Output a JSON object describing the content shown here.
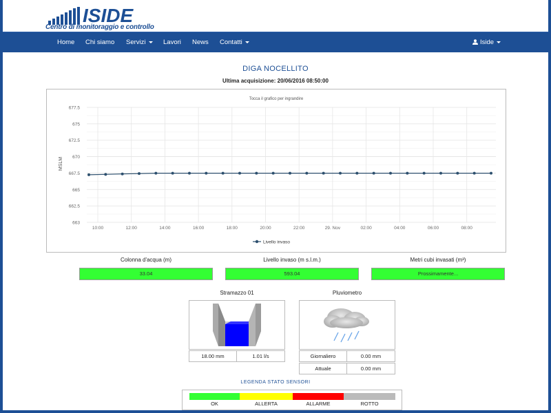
{
  "logo": {
    "text": "ISIDE",
    "subtitle": "Centro di monitoraggio e controllo"
  },
  "nav": {
    "items": [
      "Home",
      "Chi siamo",
      "Servizi",
      "Lavori",
      "News",
      "Contatti"
    ],
    "user": "Iside"
  },
  "station": {
    "title": "DIGA NOCELLITO",
    "acq_label": "Ultima acquisizione:",
    "acq_value": "20/06/2016 08:50:00"
  },
  "chart_data": {
    "type": "line",
    "title": "Tocca il grafico per ingrandire",
    "ylabel": "MSLM",
    "ylim": [
      663,
      677.5
    ],
    "yticks": [
      "677.5",
      "675",
      "672.5",
      "670",
      "667.5",
      "665",
      "662.5",
      "663"
    ],
    "xticks": [
      "10:00",
      "12:00",
      "14:00",
      "16:00",
      "18:00",
      "20:00",
      "22:00",
      "29. Nov",
      "02:00",
      "04:00",
      "06:00",
      "08:00"
    ],
    "grid": true,
    "legend_position": "bottom",
    "series": [
      {
        "name": "Livello invaso",
        "color": "#2c4f6e",
        "values": [
          669.0,
          669.05,
          669.1,
          669.15,
          669.2,
          669.2,
          669.2,
          669.2,
          669.2,
          669.2,
          669.2,
          669.2,
          669.2,
          669.2,
          669.2,
          669.2,
          669.2,
          669.2,
          669.2,
          669.2,
          669.2,
          669.2,
          669.2,
          669.2,
          669.2
        ]
      }
    ]
  },
  "stats": [
    {
      "label": "Colonna d'acqua (m)",
      "value": "33.04"
    },
    {
      "label": "Livello invaso (m s.l.m.)",
      "value": "593.04"
    },
    {
      "label": "Metri cubi invasati (m³)",
      "value": "Prossimamente..."
    }
  ],
  "sensors": {
    "stramazzo": {
      "title": "Stramazzo 01",
      "height": "18.00 mm",
      "flow": "1.01 l/s"
    },
    "pluviometro": {
      "title": "Pluviometro",
      "rows": [
        {
          "label": "Giornaliero",
          "value": "0.00 mm"
        },
        {
          "label": "Attuale",
          "value": "0.00 mm"
        }
      ]
    }
  },
  "legend": {
    "title": "LEGENDA STATO SENSORI",
    "items": [
      {
        "label": "OK",
        "color": "#33ff33"
      },
      {
        "label": "ALLERTA",
        "color": "#ffff00"
      },
      {
        "label": "ALLARME",
        "color": "#ff0000"
      },
      {
        "label": "ROTTO",
        "color": "#bbbbbb"
      }
    ]
  }
}
